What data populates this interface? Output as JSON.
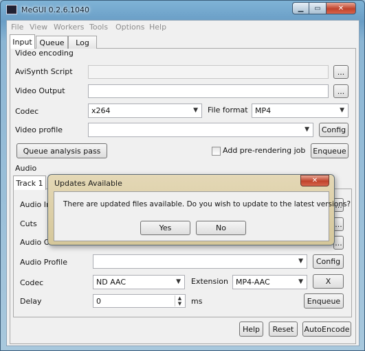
{
  "window": {
    "title": "MeGUI 0.2.6.1040",
    "close_label": "✕",
    "min_label": "▁",
    "max_label": "▭"
  },
  "menu": [
    "File",
    "View",
    "Workers",
    "Tools",
    "Options",
    "Help"
  ],
  "tabs": [
    "Input",
    "Queue",
    "Log"
  ],
  "video": {
    "section": "Video encoding",
    "avisynth_label": "AviSynth Script",
    "avisynth_value": "",
    "output_label": "Video Output",
    "output_value": "",
    "browse_label": "...",
    "codec_label": "Codec",
    "codec_value": "x264",
    "file_format_label": "File format",
    "file_format_value": "MP4",
    "profile_label": "Video profile",
    "profile_value": "",
    "config_label": "Config",
    "queue_analysis_label": "Queue analysis pass",
    "add_prerender_label": "Add pre-rendering job",
    "add_prerender_checked": false,
    "enqueue_label": "Enqueue"
  },
  "audio": {
    "section": "Audio",
    "tab_label": "Track 1",
    "input_label": "Audio In",
    "cuts_label": "Cuts",
    "output_label": "Audio O",
    "profile_label": "Audio Profile",
    "profile_value": "",
    "config_label": "Config",
    "codec_label": "Codec",
    "codec_value": "ND AAC",
    "extension_label": "Extension",
    "extension_value": "MP4-AAC",
    "x_label": "X",
    "delay_label": "Delay",
    "delay_value": "0",
    "delay_unit": "ms",
    "enqueue_label": "Enqueue"
  },
  "footer": {
    "help_label": "Help",
    "reset_label": "Reset",
    "autoencode_label": "AutoEncode"
  },
  "dialog": {
    "title": "Updates Available",
    "close_label": "✕",
    "message": "There are updated files available.  Do you wish to update to the latest versions?",
    "yes_label": "Yes",
    "no_label": "No"
  }
}
